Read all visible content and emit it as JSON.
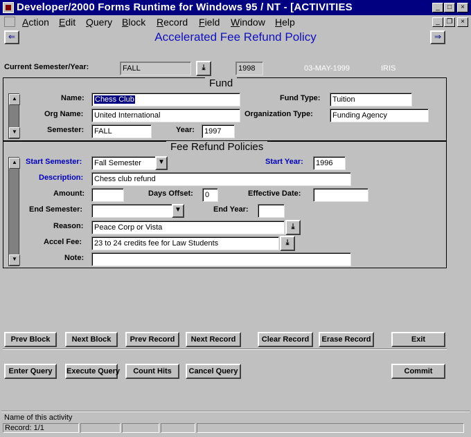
{
  "window": {
    "title": "Developer/2000 Forms Runtime for Windows 95 / NT - [ACTIVITIES"
  },
  "menu": [
    {
      "label": "Action",
      "u": "A",
      "rest": "ction"
    },
    {
      "label": "Edit",
      "u": "E",
      "rest": "dit"
    },
    {
      "label": "Query",
      "u": "Q",
      "rest": "uery"
    },
    {
      "label": "Block",
      "u": "B",
      "rest": "lock"
    },
    {
      "label": "Record",
      "u": "R",
      "rest": "ecord"
    },
    {
      "label": "Field",
      "u": "F",
      "rest": "ield"
    },
    {
      "label": "Window",
      "u": "W",
      "rest": "indow"
    },
    {
      "label": "Help",
      "u": "H",
      "rest": "elp"
    }
  ],
  "form": {
    "title": "Accelerated Fee Refund Policy"
  },
  "header": {
    "current_label": "Current Semester/Year:",
    "semester": "FALL",
    "year": "1998",
    "date": "03-MAY-1999",
    "user": "IRIS"
  },
  "fund": {
    "section_title": "Fund",
    "name_label": "Name:",
    "name_value": "Chess Club",
    "fund_type_label": "Fund Type:",
    "fund_type_value": "Tuition",
    "org_name_label": "Org Name:",
    "org_name_value": "United International",
    "org_type_label": "Organization Type:",
    "org_type_value": "Funding Agency",
    "semester_label": "Semester:",
    "semester_value": "FALL",
    "year_label": "Year:",
    "year_value": "1997"
  },
  "policy": {
    "section_title": "Fee Refund Policies",
    "start_semester_label": "Start Semester:",
    "start_semester_value": "Fall Semester",
    "start_year_label": "Start Year:",
    "start_year_value": "1996",
    "description_label": "Description:",
    "description_value": "Chess club refund",
    "amount_label": "Amount:",
    "amount_value": "",
    "days_offset_label": "Days Offset:",
    "days_offset_value": "0",
    "effective_date_label": "Effective Date:",
    "effective_date_value": "",
    "end_semester_label": "End Semester:",
    "end_semester_value": "",
    "end_year_label": "End Year:",
    "end_year_value": "",
    "reason_label": "Reason:",
    "reason_value": "Peace Corp or Vista",
    "accel_fee_label": "Accel Fee:",
    "accel_fee_value": "23 to 24 credits fee for Law Students",
    "note_label": "Note:",
    "note_value": ""
  },
  "buttons": {
    "prev_block": "Prev Block",
    "next_block": "Next Block",
    "prev_record": "Prev Record",
    "next_record": "Next Record",
    "clear_record": "Clear Record",
    "erase_record": "Erase Record",
    "exit": "Exit",
    "enter_query": "Enter Query",
    "execute_query": "Execute Query",
    "count_hits": "Count Hits",
    "cancel_query": "Cancel Query",
    "commit": "Commit"
  },
  "status": {
    "hint": "Name of this activity",
    "record": "Record: 1/1"
  },
  "icons": {
    "back": "arrow-left-icon",
    "forward": "arrow-right-icon",
    "dropdown": "chevron-down-icon",
    "lov": "download-arrow-icon"
  },
  "colors": {
    "titlebar": "#000080",
    "form_title": "#1010c0",
    "blue_label": "#0000c0",
    "selection": "#000080"
  }
}
